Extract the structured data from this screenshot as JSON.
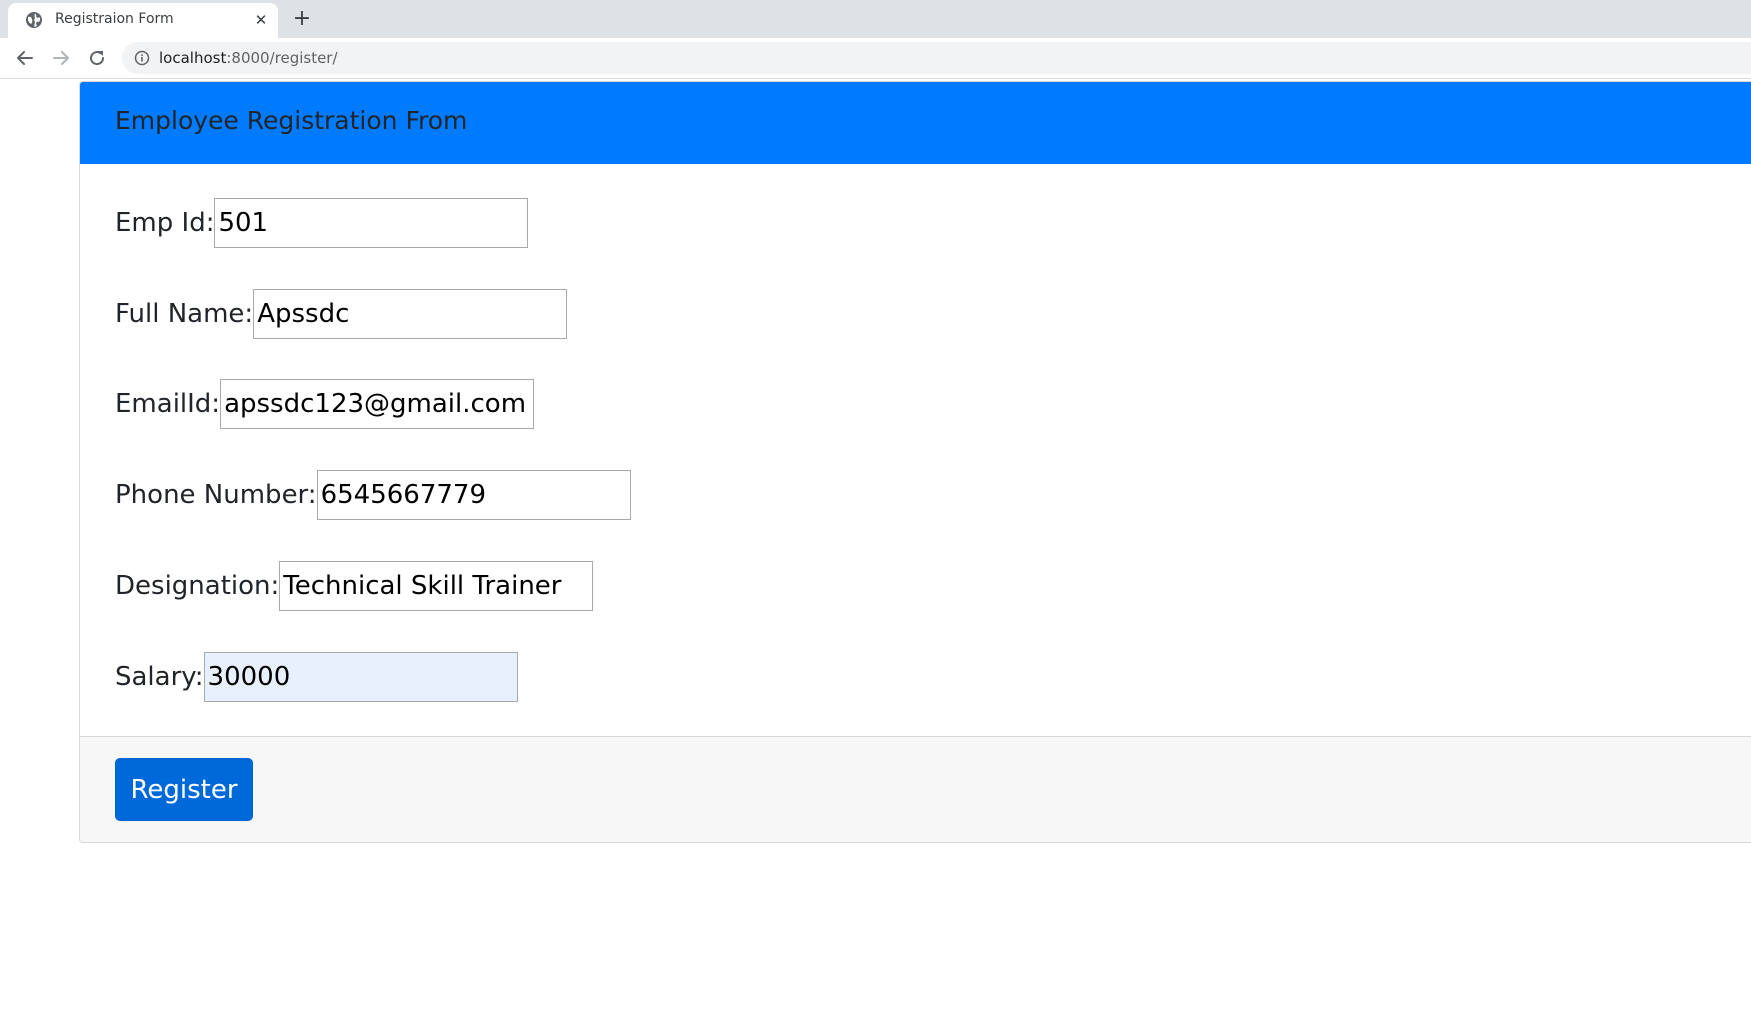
{
  "browser": {
    "tab_title": "Registraion Form",
    "tab_close_icon": "close-icon",
    "new_tab_icon": "plus-icon",
    "url_host": "localhost",
    "url_path": ":8000/register/"
  },
  "form": {
    "header_title": "Employee Registration From",
    "header_color": "#007bff",
    "fields": [
      {
        "label": "Emp Id:",
        "value": "501"
      },
      {
        "label": "Full Name:",
        "value": "Apssdc"
      },
      {
        "label": "EmailId:",
        "value": "apssdc123@gmail.com"
      },
      {
        "label": "Phone Number:",
        "value": "6545667779"
      },
      {
        "label": "Designation:",
        "value": "Technical Skill Trainer"
      },
      {
        "label": "Salary:",
        "value": "30000"
      }
    ],
    "submit_label": "Register",
    "submit_color": "#0069d9"
  }
}
